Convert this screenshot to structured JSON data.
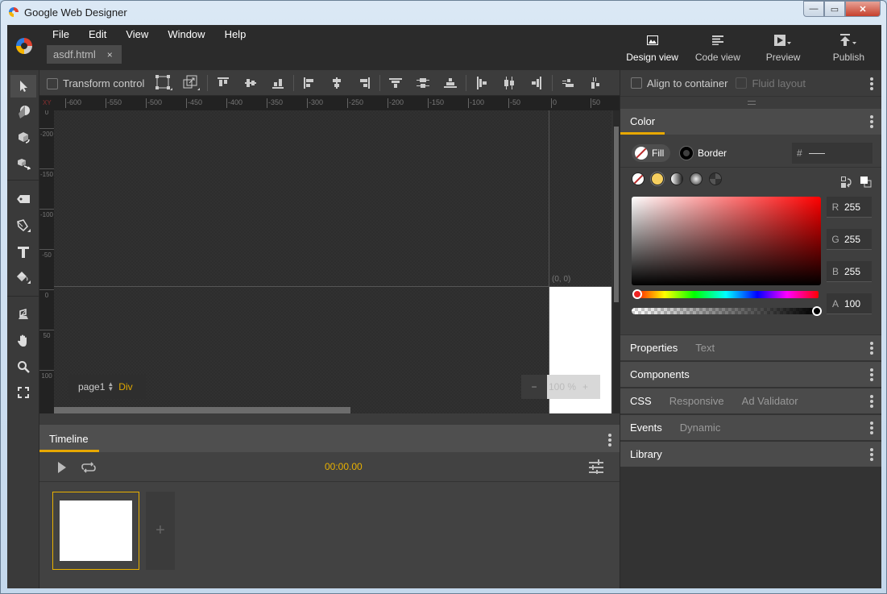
{
  "window": {
    "title": "Google Web Designer",
    "controls": {
      "minimize": "—",
      "maximize": "▭",
      "close": "✕"
    }
  },
  "menu": [
    "File",
    "Edit",
    "View",
    "Window",
    "Help"
  ],
  "document_tab": {
    "name": "asdf.html",
    "close": "×"
  },
  "view_buttons": [
    {
      "label": "Design view",
      "icon": "image-icon",
      "active": true
    },
    {
      "label": "Code view",
      "icon": "lines-icon",
      "active": false
    },
    {
      "label": "Preview",
      "icon": "play-dropdown-icon",
      "active": false
    },
    {
      "label": "Publish",
      "icon": "upload-dropdown-icon",
      "active": false
    }
  ],
  "tools": [
    "selection-tool",
    "3d-rotation-tool",
    "3d-translation-tool",
    "3d-object-tool",
    "tag-tool",
    "pen-tool",
    "text-tool",
    "fill-tool",
    "stage-tool",
    "hand-tool",
    "zoom-tool",
    "fullscreen-tool"
  ],
  "tool_options": {
    "transform_control_label": "Transform control",
    "transform_control_checked": false
  },
  "rulers": {
    "corner": "XY",
    "horizontal": [
      "-600",
      "-550",
      "-500",
      "-450",
      "-400",
      "-350",
      "-300",
      "-250",
      "-200",
      "-150",
      "-100",
      "-50",
      "0",
      "50"
    ],
    "vertical": [
      "0",
      "-200",
      "-150",
      "-100",
      "-50",
      "0",
      "50",
      "100"
    ]
  },
  "stage": {
    "origin_label": "(0, 0)",
    "breadcrumb": {
      "page": "page1",
      "element": "Div"
    },
    "zoom": {
      "minus": "−",
      "value": "100 %",
      "plus": "+"
    }
  },
  "timeline": {
    "tab": "Timeline",
    "time": "00:00.00",
    "add_page": "+"
  },
  "right_panel": {
    "align_to_container": {
      "label": "Align to container",
      "checked": false
    },
    "fluid_layout": {
      "label": "Fluid layout",
      "checked": false,
      "disabled": true
    },
    "color": {
      "title": "Color",
      "fill_label": "Fill",
      "border_label": "Border",
      "hex_prefix": "#",
      "hex_value": "",
      "swatch_types": [
        "no-fill",
        "solid",
        "linear-gradient",
        "radial-gradient",
        "image"
      ],
      "channels": [
        {
          "key": "R",
          "value": "255"
        },
        {
          "key": "G",
          "value": "255"
        },
        {
          "key": "B",
          "value": "255"
        },
        {
          "key": "A",
          "value": "100"
        }
      ],
      "hue_position": 0,
      "alpha_percent": 100
    },
    "sections": [
      {
        "title": "Properties",
        "tabs": [
          "Text"
        ]
      },
      {
        "title": "Components",
        "tabs": []
      },
      {
        "title": "CSS",
        "tabs": [
          "Responsive",
          "Ad Validator"
        ]
      },
      {
        "title": "Events",
        "tabs": [
          "Dynamic"
        ]
      },
      {
        "title": "Library",
        "tabs": []
      }
    ]
  },
  "colors": {
    "accent": "#e8a800",
    "panel_bg": "#333333",
    "header_bg": "#2b2b2b"
  }
}
